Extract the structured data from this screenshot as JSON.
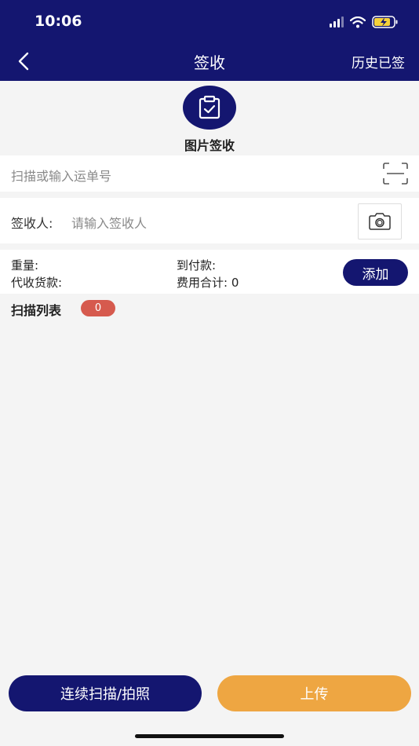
{
  "status_bar": {
    "time": "10:06"
  },
  "nav": {
    "title": "签收",
    "history_label": "历史已签"
  },
  "photo_sign": {
    "label": "图片签收"
  },
  "scan": {
    "placeholder": "扫描或输入运单号"
  },
  "signer": {
    "label": "签收人:",
    "placeholder": "请输入签收人"
  },
  "fees": {
    "weight_label": "重量:",
    "cod_label": "代收货款:",
    "to_pay_label": "到付款:",
    "total_label": "费用合计: 0"
  },
  "add_button": "添加",
  "scan_list": {
    "title": "扫描列表",
    "count": "0"
  },
  "bottom": {
    "continuous_label": "连续扫描/拍照",
    "upload_label": "上传"
  },
  "icons": [
    "back-icon",
    "signal-icon",
    "wifi-icon",
    "battery-icon",
    "clipboard-check-icon",
    "scan-frame-icon",
    "camera-icon"
  ],
  "colors": {
    "primary": "#141670",
    "accent": "#eea642",
    "badge": "#d65a4e",
    "background": "#f4f4f4"
  }
}
